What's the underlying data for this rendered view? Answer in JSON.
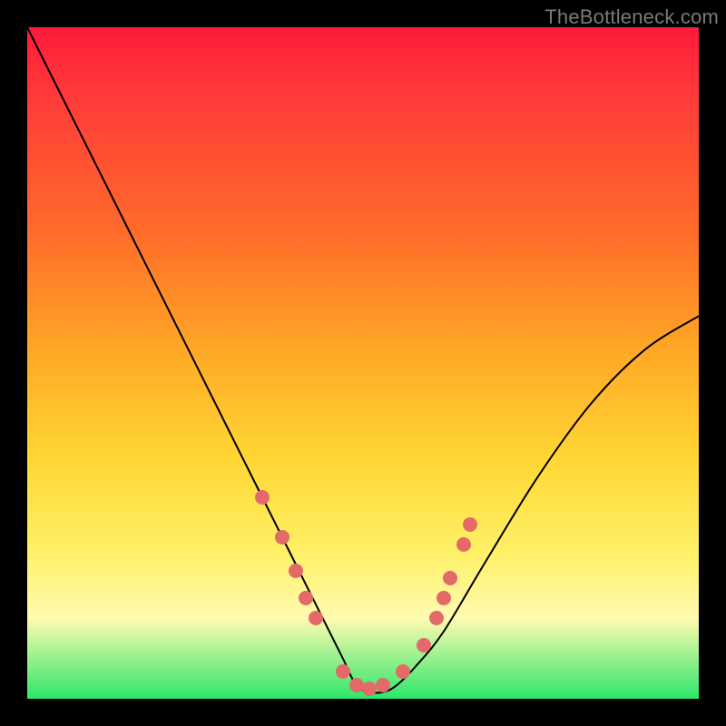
{
  "watermark": "TheBottleneck.com",
  "colors": {
    "dot": "#e46a6a",
    "curve": "#000000"
  },
  "chart_data": {
    "type": "line",
    "title": "",
    "xlabel": "",
    "ylabel": "",
    "xlim": [
      0,
      100
    ],
    "ylim": [
      0,
      100
    ],
    "grid": false,
    "legend": false,
    "series": [
      {
        "name": "bottleneck-curve",
        "x": [
          0,
          6,
          12,
          18,
          24,
          30,
          35,
          40,
          44,
          47,
          49,
          51,
          53,
          55,
          58,
          62,
          68,
          76,
          84,
          92,
          100
        ],
        "y": [
          100,
          88,
          76,
          64,
          52,
          40,
          30,
          20,
          12,
          6,
          2,
          1,
          1,
          2,
          5,
          10,
          20,
          33,
          44,
          52,
          57
        ]
      }
    ],
    "markers": [
      {
        "x": 35,
        "y": 30
      },
      {
        "x": 38,
        "y": 24
      },
      {
        "x": 40,
        "y": 19
      },
      {
        "x": 41.5,
        "y": 15
      },
      {
        "x": 43,
        "y": 12
      },
      {
        "x": 47,
        "y": 4
      },
      {
        "x": 49,
        "y": 2
      },
      {
        "x": 51,
        "y": 1.5
      },
      {
        "x": 53,
        "y": 2
      },
      {
        "x": 56,
        "y": 4
      },
      {
        "x": 59,
        "y": 8
      },
      {
        "x": 61,
        "y": 12
      },
      {
        "x": 62,
        "y": 15
      },
      {
        "x": 63,
        "y": 18
      },
      {
        "x": 65,
        "y": 23
      },
      {
        "x": 66,
        "y": 26
      }
    ]
  }
}
